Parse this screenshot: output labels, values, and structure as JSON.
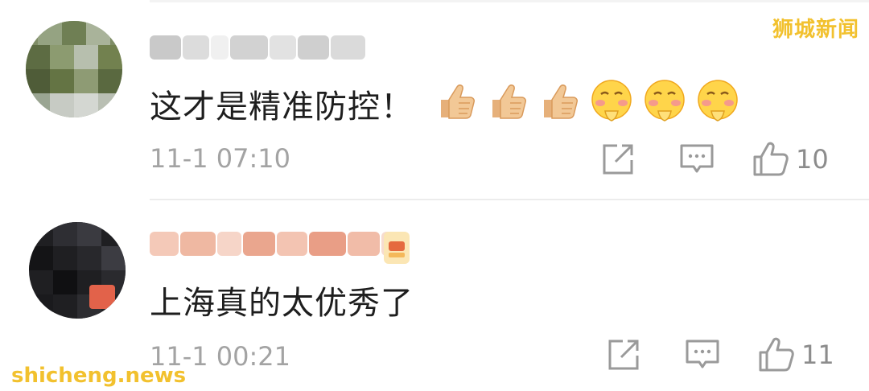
{
  "watermarks": {
    "top_right": "狮城新闻",
    "bottom_left": "shicheng.news"
  },
  "comments": [
    {
      "text": "这才是精准防控！",
      "emojis": [
        "thumbs-up",
        "thumbs-up",
        "thumbs-up",
        "shy-face",
        "shy-face",
        "shy-face"
      ],
      "timestamp": "11-1 07:10",
      "likes": "10"
    },
    {
      "text": "上海真的太优秀了",
      "emojis": [],
      "timestamp": "11-1 00:21",
      "likes": "11"
    }
  ],
  "colors": {
    "watermark": "#f2c12e",
    "meta_text": "#a3a3a3",
    "icon_stroke": "#9a9a9a"
  }
}
